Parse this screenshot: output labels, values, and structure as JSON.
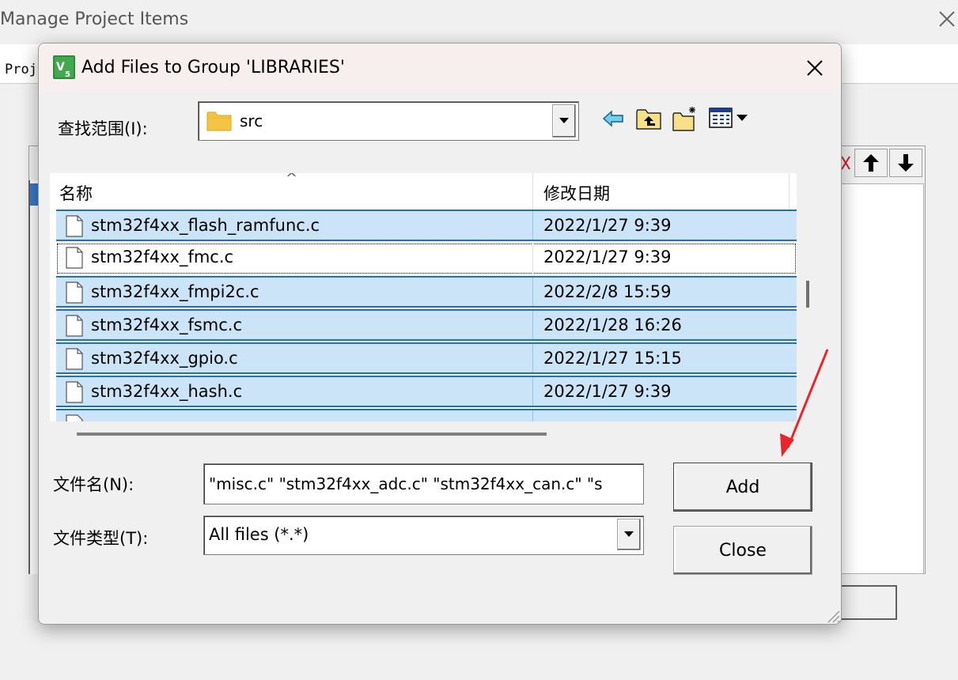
{
  "background_window": {
    "title": "Manage Project Items",
    "proj_fragment": "Proj"
  },
  "dialog": {
    "title": "Add Files to Group 'LIBRARIES'",
    "look_in_label": "查找范围(I):",
    "look_in_value": "src",
    "columns": {
      "name": "名称",
      "date": "修改日期"
    },
    "files": [
      {
        "name": "stm32f4xx_flash_ramfunc.c",
        "date": "2022/1/27 9:39",
        "selected": true
      },
      {
        "name": "stm32f4xx_fmc.c",
        "date": "2022/1/27 9:39",
        "selected": false
      },
      {
        "name": "stm32f4xx_fmpi2c.c",
        "date": "2022/2/8 15:59",
        "selected": true
      },
      {
        "name": "stm32f4xx_fsmc.c",
        "date": "2022/1/28 16:26",
        "selected": true
      },
      {
        "name": "stm32f4xx_gpio.c",
        "date": "2022/1/27 15:15",
        "selected": true
      },
      {
        "name": "stm32f4xx_hash.c",
        "date": "2022/1/27 9:39",
        "selected": true
      }
    ],
    "filename_label": "文件名(N):",
    "filename_value": "\"misc.c\" \"stm32f4xx_adc.c\" \"stm32f4xx_can.c\" \"s",
    "filetype_label": "文件类型(T):",
    "filetype_value": "All files (*.*)",
    "add_label": "Add",
    "close_label": "Close"
  },
  "colors": {
    "selection_bg": "#cce4f7",
    "selection_border": "#1e70c0",
    "annotation_arrow": "#e8252a"
  }
}
